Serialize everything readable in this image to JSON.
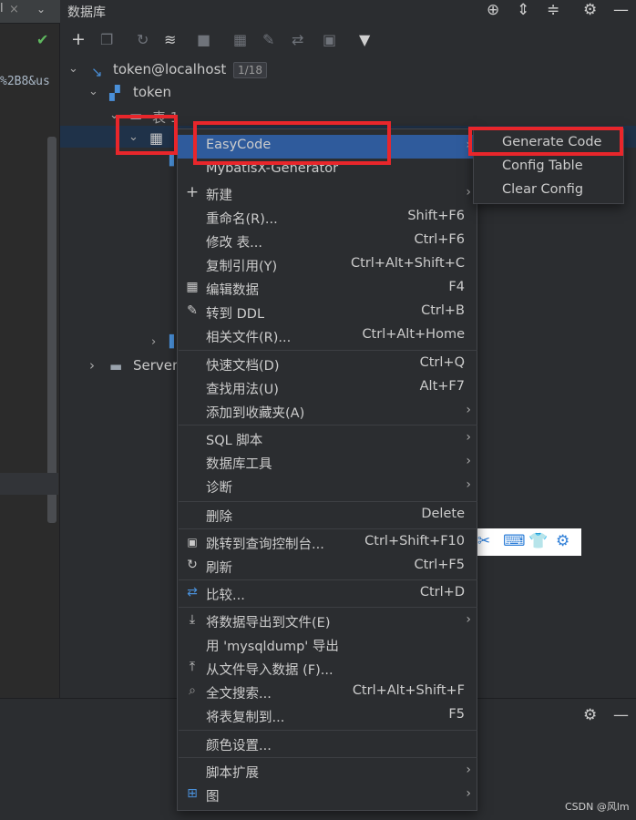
{
  "left_editor": {
    "tab_label": "l",
    "close_glyph": "×",
    "chevron_glyph": "⌄",
    "check_glyph": "✔",
    "code_fragment": "%2B8&us"
  },
  "db_panel": {
    "title": "数据库",
    "header_icons": [
      "target-icon",
      "expand-all-icon",
      "collapse-all-icon",
      "gear-icon",
      "minimize-icon"
    ],
    "toolbar_icons": [
      "add-icon",
      "copy-icon",
      "refresh-icon",
      "schema-icon",
      "stop-icon",
      "table-icon",
      "edit-icon",
      "compare-icon",
      "console-icon",
      "filter-icon"
    ]
  },
  "tree": {
    "connection": {
      "label": "token@localhost",
      "badge": "1/18"
    },
    "schema": {
      "label": "token"
    },
    "tables_folder": {
      "label": "表 1"
    },
    "server_objects": {
      "label": "Server"
    }
  },
  "context_menu": {
    "items": [
      {
        "label": "EasyCode",
        "shortcut": "",
        "submenu": true,
        "icon": ""
      },
      {
        "label": "MybatisX-Generator",
        "shortcut": "",
        "submenu": false,
        "icon": ""
      },
      {
        "label": "新建",
        "shortcut": "",
        "submenu": true,
        "icon": "plus-icon"
      },
      {
        "label": "重命名(R)...",
        "shortcut": "Shift+F6",
        "submenu": false,
        "icon": ""
      },
      {
        "label": "修改 表...",
        "shortcut": "Ctrl+F6",
        "submenu": false,
        "icon": ""
      },
      {
        "label": "复制引用(Y)",
        "shortcut": "Ctrl+Alt+Shift+C",
        "submenu": false,
        "icon": ""
      },
      {
        "label": "编辑数据",
        "shortcut": "F4",
        "submenu": false,
        "icon": "table-grid-icon"
      },
      {
        "label": "转到 DDL",
        "shortcut": "Ctrl+B",
        "submenu": false,
        "icon": "pencil-icon"
      },
      {
        "label": "相关文件(R)...",
        "shortcut": "Ctrl+Alt+Home",
        "submenu": false,
        "icon": ""
      },
      {
        "label": "快速文档(D)",
        "shortcut": "Ctrl+Q",
        "submenu": false,
        "icon": ""
      },
      {
        "label": "查找用法(U)",
        "shortcut": "Alt+F7",
        "submenu": false,
        "icon": ""
      },
      {
        "label": "添加到收藏夹(A)",
        "shortcut": "",
        "submenu": true,
        "icon": ""
      },
      {
        "label": "SQL 脚本",
        "shortcut": "",
        "submenu": true,
        "icon": ""
      },
      {
        "label": "数据库工具",
        "shortcut": "",
        "submenu": true,
        "icon": ""
      },
      {
        "label": "诊断",
        "shortcut": "",
        "submenu": true,
        "icon": ""
      },
      {
        "label": "删除",
        "shortcut": "Delete",
        "submenu": false,
        "icon": ""
      },
      {
        "label": "跳转到查询控制台...",
        "shortcut": "Ctrl+Shift+F10",
        "submenu": false,
        "icon": "console-icon"
      },
      {
        "label": "刷新",
        "shortcut": "Ctrl+F5",
        "submenu": false,
        "icon": "refresh-icon"
      },
      {
        "label": "比较...",
        "shortcut": "Ctrl+D",
        "submenu": false,
        "icon": "compare-icon"
      },
      {
        "label": "将数据导出到文件(E)",
        "shortcut": "",
        "submenu": true,
        "icon": "export-icon"
      },
      {
        "label": "用 'mysqldump' 导出",
        "shortcut": "",
        "submenu": false,
        "icon": ""
      },
      {
        "label": "从文件导入数据 (F)...",
        "shortcut": "",
        "submenu": false,
        "icon": "import-icon"
      },
      {
        "label": "全文搜索...",
        "shortcut": "Ctrl+Alt+Shift+F",
        "submenu": false,
        "icon": "search-icon"
      },
      {
        "label": "将表复制到...",
        "shortcut": "F5",
        "submenu": false,
        "icon": ""
      },
      {
        "label": "颜色设置...",
        "shortcut": "",
        "submenu": false,
        "icon": ""
      },
      {
        "label": "脚本扩展",
        "shortcut": "",
        "submenu": true,
        "icon": ""
      },
      {
        "label": "图",
        "shortcut": "",
        "submenu": true,
        "icon": "diagram-icon"
      }
    ]
  },
  "easycode_submenu": {
    "items": [
      {
        "label": "Generate Code"
      },
      {
        "label": "Config Table"
      },
      {
        "label": "Clear Config"
      }
    ]
  },
  "bottom_panel": {
    "icons": [
      "gear-icon",
      "minimize-icon"
    ]
  },
  "watermark": "CSDN @风lm",
  "colors": {
    "background": "#2b2d30",
    "selection": "#2f5b9c",
    "highlight_box": "#e8262b"
  }
}
